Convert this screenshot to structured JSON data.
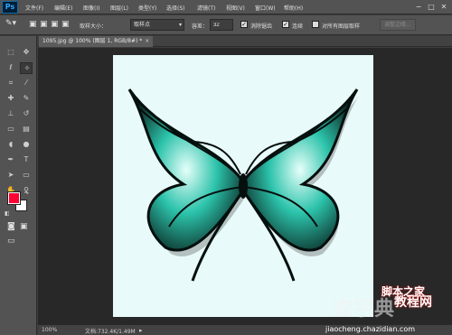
{
  "app": {
    "logo": "Ps"
  },
  "menu": [
    {
      "label": "文件(F)",
      "id": "file"
    },
    {
      "label": "编辑(E)",
      "id": "edit"
    },
    {
      "label": "图像(I)",
      "id": "image"
    },
    {
      "label": "图层(L)",
      "id": "layer"
    },
    {
      "label": "类型(Y)",
      "id": "type"
    },
    {
      "label": "选择(S)",
      "id": "select"
    },
    {
      "label": "滤镜(T)",
      "id": "filter"
    },
    {
      "label": "视图(V)",
      "id": "view"
    },
    {
      "label": "窗口(W)",
      "id": "window"
    },
    {
      "label": "帮助(H)",
      "id": "help"
    }
  ],
  "window_controls": {
    "minimize": "−",
    "restore": "□",
    "close": "✕"
  },
  "options": {
    "sample_size_label": "取样大小：",
    "sample_size_value": "取样点",
    "tolerance_label": "容差：",
    "tolerance_value": "32",
    "anti_alias_label": "消除锯齿",
    "anti_alias_checked": true,
    "contiguous_label": "连续",
    "contiguous_checked": true,
    "sample_all_layers_label": "对所有图层取样",
    "sample_all_layers_checked": false,
    "refine_edge_label": "调整边缘..."
  },
  "document": {
    "tab_title": "1095.jpg @ 100% (图层 1, RGB/8#) *",
    "tab_close": "×"
  },
  "status": {
    "zoom": "100%",
    "doc_size": "文档:732.4K/1.49M"
  },
  "colors": {
    "foreground": "#ff0033",
    "background": "#ffffff",
    "canvas_bg": "#e8fafa",
    "wing_teal": "#1fbfa8",
    "wing_dark": "#0a1a16"
  },
  "tools": [
    {
      "name": "marquee-tool-icon",
      "glyph": "⬚"
    },
    {
      "name": "move-tool-icon",
      "glyph": "✥"
    },
    {
      "name": "lasso-tool-icon",
      "glyph": "ℓ"
    },
    {
      "name": "magic-wand-tool-icon",
      "glyph": "✧"
    },
    {
      "name": "crop-tool-icon",
      "glyph": "⌗"
    },
    {
      "name": "eyedropper-tool-icon",
      "glyph": "⁄"
    },
    {
      "name": "healing-brush-tool-icon",
      "glyph": "✚"
    },
    {
      "name": "brush-tool-icon",
      "glyph": "✎"
    },
    {
      "name": "clone-stamp-tool-icon",
      "glyph": "⊥"
    },
    {
      "name": "history-brush-tool-icon",
      "glyph": "↺"
    },
    {
      "name": "eraser-tool-icon",
      "glyph": "▭"
    },
    {
      "name": "gradient-tool-icon",
      "glyph": "▤"
    },
    {
      "name": "blur-tool-icon",
      "glyph": "◖"
    },
    {
      "name": "dodge-tool-icon",
      "glyph": "●"
    },
    {
      "name": "pen-tool-icon",
      "glyph": "✒"
    },
    {
      "name": "type-tool-icon",
      "glyph": "T"
    },
    {
      "name": "path-selection-tool-icon",
      "glyph": "➤"
    },
    {
      "name": "shape-tool-icon",
      "glyph": "▭"
    },
    {
      "name": "hand-tool-icon",
      "glyph": "✋"
    },
    {
      "name": "zoom-tool-icon",
      "glyph": "⚲"
    }
  ],
  "watermark": {
    "line1": "查字典",
    "line2": "教程网",
    "url": "jiaocheng.chazidian.com",
    "badge": "脚本之家"
  }
}
